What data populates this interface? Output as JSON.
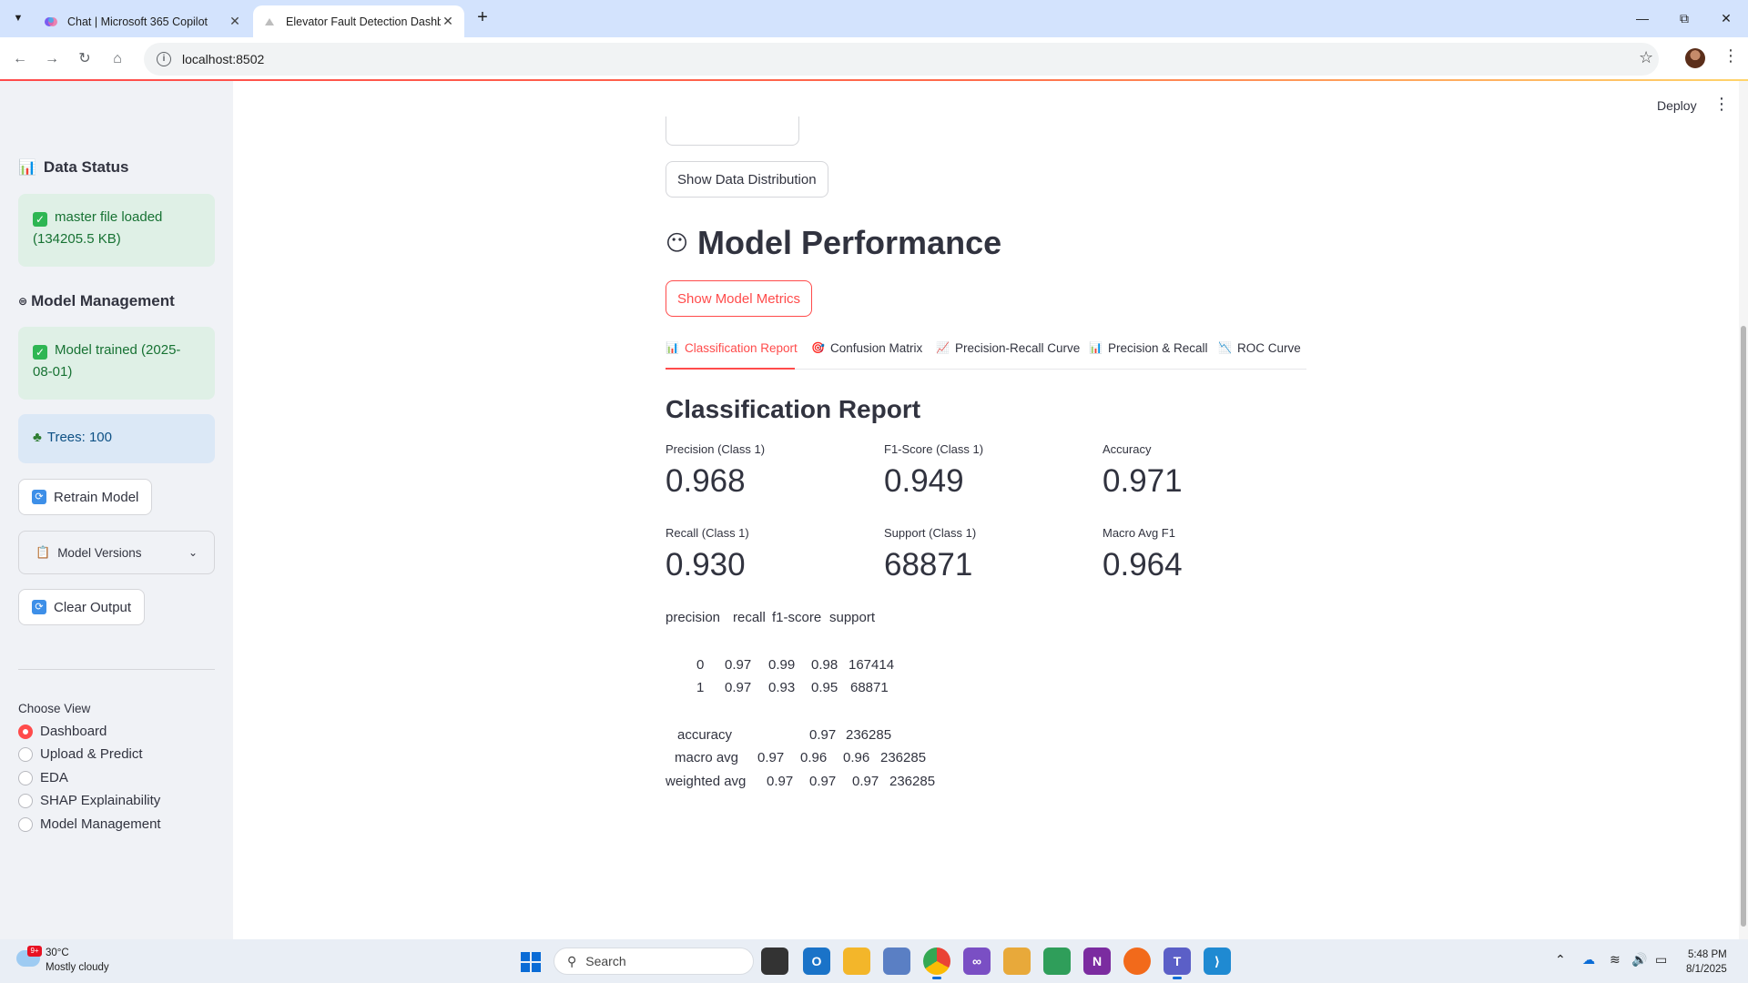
{
  "browser": {
    "tabs": [
      {
        "title": "Chat | Microsoft 365 Copilot",
        "active": false
      },
      {
        "title": "Elevator Fault Detection Dashb",
        "active": true
      }
    ],
    "url": "localhost:8502"
  },
  "app": {
    "deploy_label": "Deploy",
    "sidebar": {
      "data_status_heading": "Data Status",
      "data_status_message": "master file loaded (134205.5 KB)",
      "model_mgmt_heading": "Model Management",
      "model_trained_message": "Model trained (2025-08-01)",
      "trees_message": "Trees: 100",
      "retrain_label": "Retrain Model",
      "versions_label": "Model Versions",
      "clear_label": "Clear Output",
      "choose_view_label": "Choose View",
      "views": [
        "Dashboard",
        "Upload & Predict",
        "EDA",
        "SHAP Explainability",
        "Model Management"
      ],
      "selected_view": "Dashboard"
    },
    "main": {
      "show_distribution_label": "Show Data Distribution",
      "section_title": "Model Performance",
      "show_metrics_label": "Show Model Metrics",
      "tabs": [
        "Classification Report",
        "Confusion Matrix",
        "Precision-Recall Curve",
        "Precision & Recall",
        "ROC Curve"
      ],
      "active_tab": "Classification Report",
      "report_title": "Classification Report",
      "metrics": [
        {
          "label": "Precision (Class 1)",
          "value": "0.968"
        },
        {
          "label": "F1-Score (Class 1)",
          "value": "0.949"
        },
        {
          "label": "Accuracy",
          "value": "0.971"
        },
        {
          "label": "Recall (Class 1)",
          "value": "0.930"
        },
        {
          "label": "Support (Class 1)",
          "value": "68871"
        },
        {
          "label": "Macro Avg F1",
          "value": "0.964"
        }
      ],
      "report_text": {
        "header": [
          "precision",
          "recall",
          "f1-score",
          "support"
        ],
        "rows": [
          {
            "label": "0",
            "values": [
              "0.97",
              "0.99",
              "0.98",
              "167414"
            ]
          },
          {
            "label": "1",
            "values": [
              "0.97",
              "0.93",
              "0.95",
              "68871"
            ]
          },
          {
            "label": "accuracy",
            "values": [
              "0.97",
              "236285"
            ]
          },
          {
            "label": "macro avg",
            "values": [
              "0.97",
              "0.96",
              "0.96",
              "236285"
            ]
          },
          {
            "label": "weighted avg",
            "values": [
              "0.97",
              "0.97",
              "0.97",
              "236285"
            ]
          }
        ]
      }
    }
  },
  "taskbar": {
    "weather_temp": "30°C",
    "weather_desc": "Mostly cloudy",
    "weather_badge": "9+",
    "search_placeholder": "Search",
    "time": "5:48 PM",
    "date": "8/1/2025"
  }
}
